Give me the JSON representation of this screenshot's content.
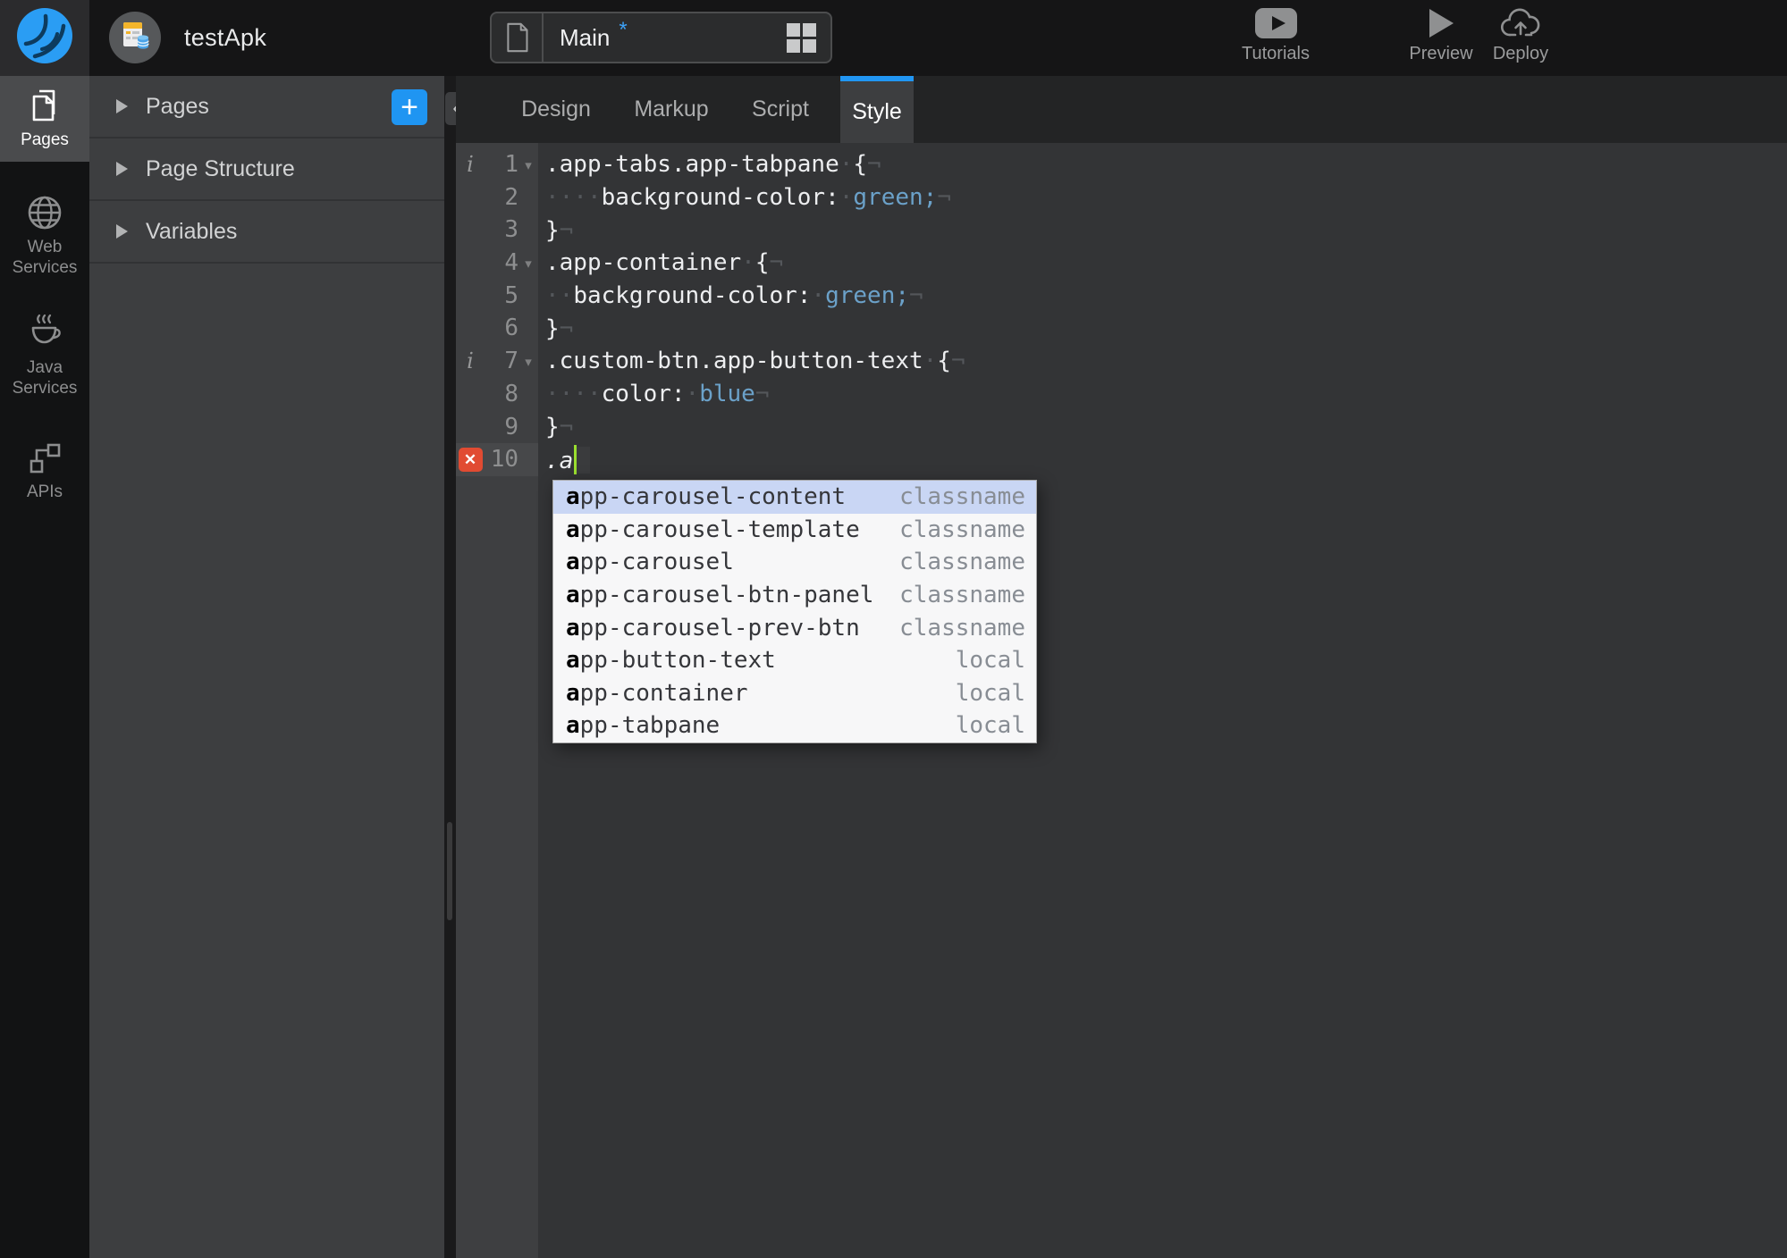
{
  "colors": {
    "accent_blue": "#2196f3",
    "error_red": "#e14b32",
    "cursor_green": "#9ade2f",
    "code_value_blue": "#6ba1c9",
    "autocomplete_selection": "#c9d6f4"
  },
  "topbar": {
    "app_title": "testApk",
    "page_selector": {
      "page": "Main",
      "dirty_marker": "*"
    },
    "actions": [
      {
        "id": "tutorials",
        "icon": "youtube-icon",
        "label": "Tutorials"
      },
      {
        "id": "preview",
        "icon": "play-icon",
        "label": "Preview"
      },
      {
        "id": "deploy",
        "icon": "cloud-upload-icon",
        "label": "Deploy"
      }
    ]
  },
  "sidebar": {
    "items": [
      {
        "id": "pages",
        "icon": "pages-icon",
        "label": "Pages",
        "active": true
      },
      {
        "id": "web-services",
        "icon": "globe-icon",
        "label": "Web Services",
        "active": false
      },
      {
        "id": "java-services",
        "icon": "coffee-icon",
        "label": "Java Services",
        "active": false
      },
      {
        "id": "apis",
        "icon": "api-icon",
        "label": "APIs",
        "active": false
      }
    ]
  },
  "explorer": {
    "collapse_glyph": "«",
    "add_button_label": "+",
    "sections": [
      {
        "id": "pages",
        "label": "Pages",
        "has_add_button": true
      },
      {
        "id": "page-structure",
        "label": "Page Structure",
        "has_add_button": false
      },
      {
        "id": "variables",
        "label": "Variables",
        "has_add_button": false
      }
    ]
  },
  "tabs": [
    {
      "label": "Design",
      "active": false
    },
    {
      "label": "Markup",
      "active": false
    },
    {
      "label": "Script",
      "active": false
    },
    {
      "label": "Style",
      "active": true
    }
  ],
  "editor": {
    "cursor_line": 10,
    "lines": [
      {
        "num": "1",
        "info": true,
        "fold": true,
        "error": false,
        "cursor": false,
        "segs": [
          [
            "p",
            ".app-tabs.app-tabpane"
          ],
          [
            "w",
            "·"
          ],
          [
            "p",
            "{"
          ],
          [
            "n",
            "¬"
          ]
        ]
      },
      {
        "num": "2",
        "info": false,
        "fold": false,
        "error": false,
        "cursor": false,
        "segs": [
          [
            "w",
            "····"
          ],
          [
            "p",
            "background-color:"
          ],
          [
            "w",
            "·"
          ],
          [
            "v",
            "green;"
          ],
          [
            "n",
            "¬"
          ]
        ]
      },
      {
        "num": "3",
        "info": false,
        "fold": false,
        "error": false,
        "cursor": false,
        "segs": [
          [
            "p",
            "}"
          ],
          [
            "n",
            "¬"
          ]
        ]
      },
      {
        "num": "4",
        "info": false,
        "fold": true,
        "error": false,
        "cursor": false,
        "segs": [
          [
            "p",
            ".app-container"
          ],
          [
            "w",
            "·"
          ],
          [
            "p",
            "{"
          ],
          [
            "n",
            "¬"
          ]
        ]
      },
      {
        "num": "5",
        "info": false,
        "fold": false,
        "error": false,
        "cursor": false,
        "segs": [
          [
            "w",
            "··"
          ],
          [
            "p",
            "background-color:"
          ],
          [
            "w",
            "·"
          ],
          [
            "v",
            "green;"
          ],
          [
            "n",
            "¬"
          ]
        ]
      },
      {
        "num": "6",
        "info": false,
        "fold": false,
        "error": false,
        "cursor": false,
        "segs": [
          [
            "p",
            "}"
          ],
          [
            "n",
            "¬"
          ]
        ]
      },
      {
        "num": "7",
        "info": true,
        "fold": true,
        "error": false,
        "cursor": false,
        "segs": [
          [
            "p",
            ".custom-btn.app-button-text"
          ],
          [
            "w",
            "·"
          ],
          [
            "p",
            "{"
          ],
          [
            "n",
            "¬"
          ]
        ]
      },
      {
        "num": "8",
        "info": false,
        "fold": false,
        "error": false,
        "cursor": false,
        "segs": [
          [
            "w",
            "····"
          ],
          [
            "p",
            "color:"
          ],
          [
            "w",
            "·"
          ],
          [
            "v",
            "blue"
          ],
          [
            "n",
            "¬"
          ]
        ]
      },
      {
        "num": "9",
        "info": false,
        "fold": false,
        "error": false,
        "cursor": false,
        "segs": [
          [
            "p",
            "}"
          ],
          [
            "n",
            "¬"
          ]
        ]
      },
      {
        "num": "10",
        "info": false,
        "fold": false,
        "error": true,
        "cursor": true,
        "segs": [
          [
            "e",
            ".a"
          ]
        ]
      }
    ]
  },
  "autocomplete": {
    "items": [
      {
        "match": "a",
        "rest": "pp-carousel-content",
        "type": "classname",
        "selected": true
      },
      {
        "match": "a",
        "rest": "pp-carousel-template",
        "type": "classname",
        "selected": false
      },
      {
        "match": "a",
        "rest": "pp-carousel",
        "type": "classname",
        "selected": false
      },
      {
        "match": "a",
        "rest": "pp-carousel-btn-panel",
        "type": "classname",
        "selected": false
      },
      {
        "match": "a",
        "rest": "pp-carousel-prev-btn",
        "type": "classname",
        "selected": false
      },
      {
        "match": "a",
        "rest": "pp-button-text",
        "type": "local",
        "selected": false
      },
      {
        "match": "a",
        "rest": "pp-container",
        "type": "local",
        "selected": false
      },
      {
        "match": "a",
        "rest": "pp-tabpane",
        "type": "local",
        "selected": false
      }
    ]
  }
}
